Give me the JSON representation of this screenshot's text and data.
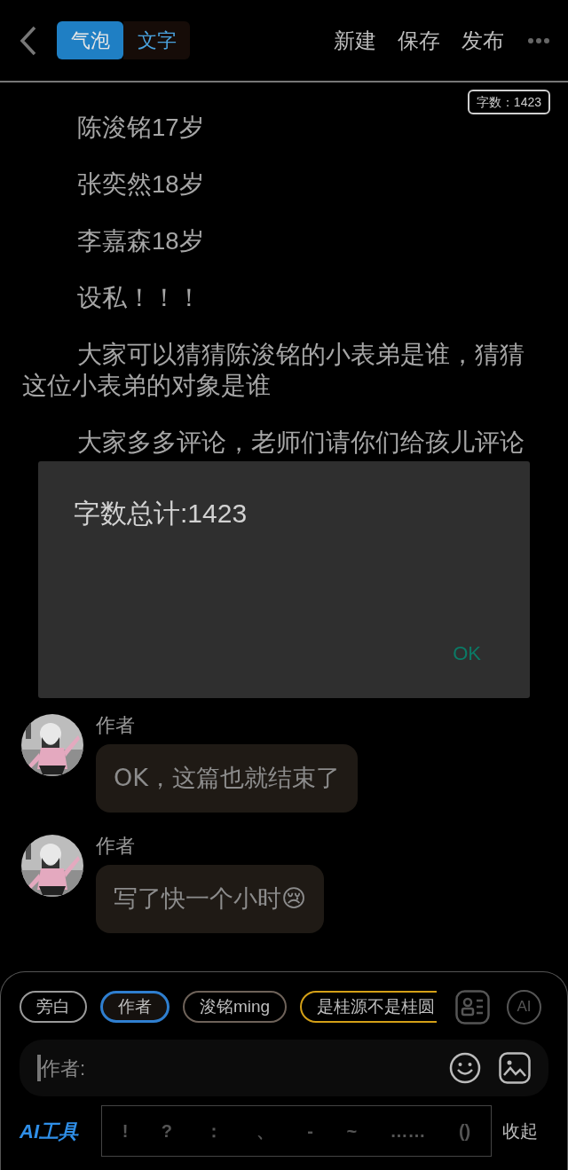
{
  "header": {
    "segments": [
      {
        "label": "气泡",
        "selected": true
      },
      {
        "label": "文字",
        "selected": false
      }
    ],
    "actions": [
      "新建",
      "保存",
      "发布"
    ]
  },
  "word_count_badge": "字数：1423",
  "paragraphs": [
    "陈浚铭17岁",
    "张奕然18岁",
    "李嘉森18岁",
    "设私！！！",
    "大家可以猜猜陈浚铭的小表弟是谁，猜猜这位小表弟的对象是谁",
    "大家多多评论，老师们请你们给孩儿评论"
  ],
  "messages": [
    {
      "author": "作者",
      "text": "OK，这篇也就结束了"
    },
    {
      "author": "作者",
      "text": "写了快一个小时😢"
    }
  ],
  "dialog": {
    "title": "字数总计:1423",
    "button": "OK"
  },
  "characters": [
    {
      "label": "旁白",
      "selected": false,
      "color": "#9a9a9a"
    },
    {
      "label": "作者",
      "selected": true,
      "color": "#2f7fd0"
    },
    {
      "label": "浚铭ming",
      "selected": false,
      "color": "#6e6259"
    },
    {
      "label": "是桂源不是桂圆",
      "selected": false,
      "color": "#d4a017"
    }
  ],
  "ai_button": "AI",
  "input": {
    "placeholder": "作者:"
  },
  "ai_tools": "AI工具",
  "punctuation": [
    "!",
    "?",
    "：",
    "、",
    "-",
    "~",
    "……",
    "()"
  ],
  "collapse": "收起"
}
